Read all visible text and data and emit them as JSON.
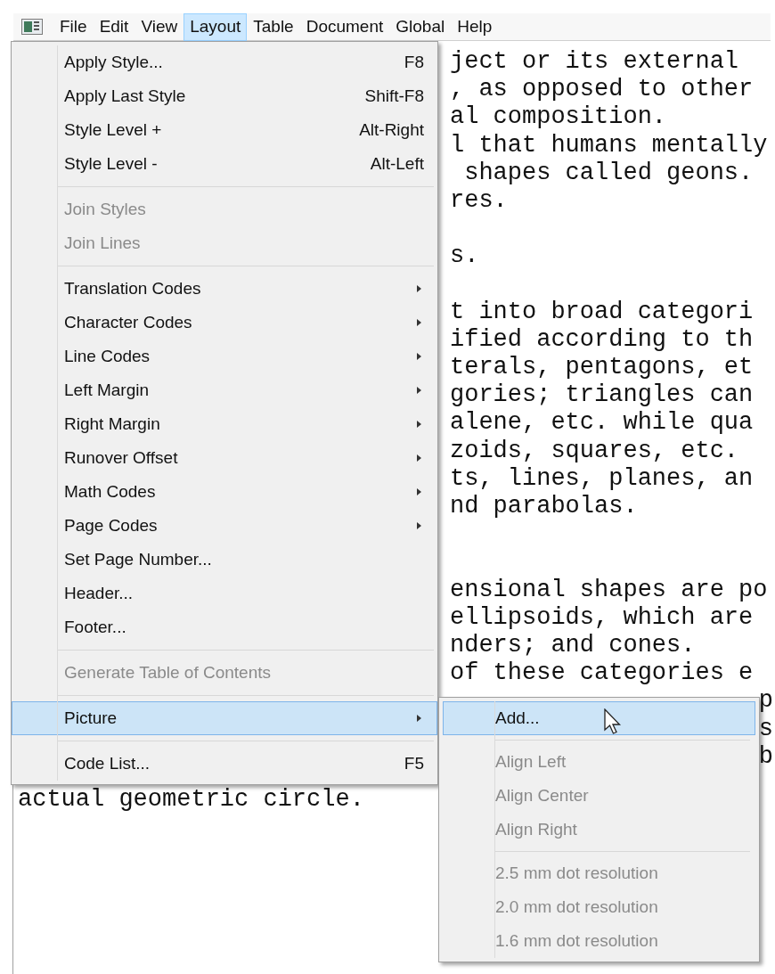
{
  "menubar": {
    "items": [
      {
        "label": "File",
        "selected": false
      },
      {
        "label": "Edit",
        "selected": false
      },
      {
        "label": "View",
        "selected": false
      },
      {
        "label": "Layout",
        "selected": true
      },
      {
        "label": "Table",
        "selected": false
      },
      {
        "label": "Document",
        "selected": false
      },
      {
        "label": "Global",
        "selected": false
      },
      {
        "label": "Help",
        "selected": false
      }
    ]
  },
  "document": {
    "lines": [
      {
        "kind": "fragment",
        "text": "ject or its external"
      },
      {
        "kind": "fragment",
        "text": ", as opposed to other"
      },
      {
        "kind": "fragment",
        "text": "al composition."
      },
      {
        "kind": "fragment",
        "text": "l that humans mentally"
      },
      {
        "kind": "fragment",
        "text": " shapes called geons."
      },
      {
        "kind": "fragment",
        "text": "res."
      },
      {
        "kind": "blank"
      },
      {
        "kind": "fragment",
        "text": "s."
      },
      {
        "kind": "blank"
      },
      {
        "kind": "fragment",
        "text": "t into broad categori"
      },
      {
        "kind": "fragment",
        "text": "ified according to th"
      },
      {
        "kind": "fragment",
        "text": "terals, pentagons, et"
      },
      {
        "kind": "fragment",
        "text": "gories; triangles can"
      },
      {
        "kind": "fragment",
        "text": "alene, etc. while qua"
      },
      {
        "kind": "fragment",
        "text": "zoids, squares, etc."
      },
      {
        "kind": "fragment",
        "text": "ts, lines, planes, an"
      },
      {
        "kind": "fragment",
        "text": "nd parabolas."
      },
      {
        "kind": "blank"
      },
      {
        "kind": "blank"
      },
      {
        "kind": "fragment",
        "text": "ensional shapes are po"
      },
      {
        "kind": "fragment",
        "text": "ellipsoids, which are"
      },
      {
        "kind": "fragment",
        "text": "nders; and cones."
      },
      {
        "kind": "fragment",
        "text": "of these categories e"
      },
      {
        "kind": "tail",
        "text": "p"
      },
      {
        "kind": "tail",
        "text": "s"
      },
      {
        "kind": "tail",
        "text": "b"
      },
      {
        "kind": "full",
        "text": "actual geometric circle."
      }
    ]
  },
  "menu": {
    "items": [
      {
        "kind": "item",
        "label": "Apply Style...",
        "shortcut": "F8",
        "submenu": false,
        "disabled": false,
        "selected": false
      },
      {
        "kind": "item",
        "label": "Apply Last Style",
        "shortcut": "Shift-F8",
        "submenu": false,
        "disabled": false,
        "selected": false
      },
      {
        "kind": "item",
        "label": "Style Level +",
        "shortcut": "Alt-Right",
        "submenu": false,
        "disabled": false,
        "selected": false
      },
      {
        "kind": "item",
        "label": "Style Level -",
        "shortcut": "Alt-Left",
        "submenu": false,
        "disabled": false,
        "selected": false
      },
      {
        "kind": "separator"
      },
      {
        "kind": "item",
        "label": "Join Styles",
        "submenu": false,
        "disabled": true,
        "selected": false
      },
      {
        "kind": "item",
        "label": "Join Lines",
        "submenu": false,
        "disabled": true,
        "selected": false
      },
      {
        "kind": "separator"
      },
      {
        "kind": "item",
        "label": "Translation Codes",
        "submenu": true,
        "disabled": false,
        "selected": false
      },
      {
        "kind": "item",
        "label": "Character Codes",
        "submenu": true,
        "disabled": false,
        "selected": false
      },
      {
        "kind": "item",
        "label": "Line Codes",
        "submenu": true,
        "disabled": false,
        "selected": false
      },
      {
        "kind": "item",
        "label": "Left Margin",
        "submenu": true,
        "disabled": false,
        "selected": false
      },
      {
        "kind": "item",
        "label": "Right Margin",
        "submenu": true,
        "disabled": false,
        "selected": false
      },
      {
        "kind": "item",
        "label": "Runover Offset",
        "submenu": true,
        "disabled": false,
        "selected": false
      },
      {
        "kind": "item",
        "label": "Math Codes",
        "submenu": true,
        "disabled": false,
        "selected": false
      },
      {
        "kind": "item",
        "label": "Page Codes",
        "submenu": true,
        "disabled": false,
        "selected": false
      },
      {
        "kind": "item",
        "label": "Set Page Number...",
        "submenu": false,
        "disabled": false,
        "selected": false
      },
      {
        "kind": "item",
        "label": "Header...",
        "submenu": false,
        "disabled": false,
        "selected": false
      },
      {
        "kind": "item",
        "label": "Footer...",
        "submenu": false,
        "disabled": false,
        "selected": false
      },
      {
        "kind": "separator"
      },
      {
        "kind": "item",
        "label": "Generate Table of Contents",
        "submenu": false,
        "disabled": true,
        "selected": false
      },
      {
        "kind": "separator"
      },
      {
        "kind": "item",
        "label": "Picture",
        "submenu": true,
        "disabled": false,
        "selected": true
      },
      {
        "kind": "separator"
      },
      {
        "kind": "item",
        "label": "Code List...",
        "shortcut": "F5",
        "submenu": false,
        "disabled": false,
        "selected": false
      }
    ]
  },
  "submenu": {
    "items": [
      {
        "kind": "item",
        "label": "Add...",
        "disabled": false,
        "selected": true
      },
      {
        "kind": "separator"
      },
      {
        "kind": "item",
        "label": "Align Left",
        "disabled": true,
        "selected": false
      },
      {
        "kind": "item",
        "label": "Align Center",
        "disabled": true,
        "selected": false
      },
      {
        "kind": "item",
        "label": "Align Right",
        "disabled": true,
        "selected": false
      },
      {
        "kind": "separator"
      },
      {
        "kind": "item",
        "label": "2.5 mm dot resolution",
        "disabled": true,
        "selected": false
      },
      {
        "kind": "item",
        "label": "2.0 mm dot resolution",
        "disabled": true,
        "selected": false
      },
      {
        "kind": "item",
        "label": "1.6 mm dot resolution",
        "disabled": true,
        "selected": false
      }
    ]
  }
}
